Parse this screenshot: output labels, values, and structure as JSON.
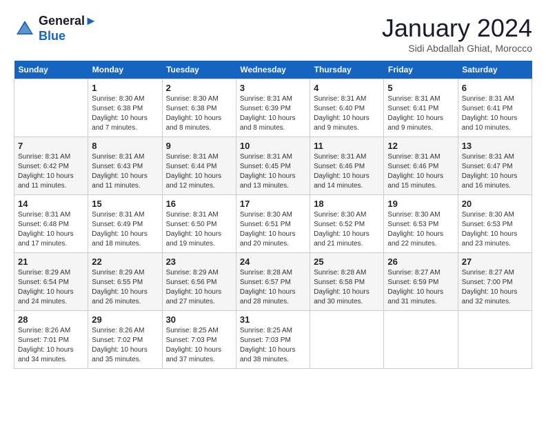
{
  "header": {
    "logo_line1": "General",
    "logo_line2": "Blue",
    "month_title": "January 2024",
    "subtitle": "Sidi Abdallah Ghiat, Morocco"
  },
  "days_of_week": [
    "Sunday",
    "Monday",
    "Tuesday",
    "Wednesday",
    "Thursday",
    "Friday",
    "Saturday"
  ],
  "weeks": [
    [
      {
        "day": "",
        "sunrise": "",
        "sunset": "",
        "daylight": ""
      },
      {
        "day": "1",
        "sunrise": "8:30 AM",
        "sunset": "6:38 PM",
        "daylight": "10 hours and 7 minutes."
      },
      {
        "day": "2",
        "sunrise": "8:30 AM",
        "sunset": "6:38 PM",
        "daylight": "10 hours and 8 minutes."
      },
      {
        "day": "3",
        "sunrise": "8:31 AM",
        "sunset": "6:39 PM",
        "daylight": "10 hours and 8 minutes."
      },
      {
        "day": "4",
        "sunrise": "8:31 AM",
        "sunset": "6:40 PM",
        "daylight": "10 hours and 9 minutes."
      },
      {
        "day": "5",
        "sunrise": "8:31 AM",
        "sunset": "6:41 PM",
        "daylight": "10 hours and 9 minutes."
      },
      {
        "day": "6",
        "sunrise": "8:31 AM",
        "sunset": "6:41 PM",
        "daylight": "10 hours and 10 minutes."
      }
    ],
    [
      {
        "day": "7",
        "sunrise": "8:31 AM",
        "sunset": "6:42 PM",
        "daylight": "10 hours and 11 minutes."
      },
      {
        "day": "8",
        "sunrise": "8:31 AM",
        "sunset": "6:43 PM",
        "daylight": "10 hours and 11 minutes."
      },
      {
        "day": "9",
        "sunrise": "8:31 AM",
        "sunset": "6:44 PM",
        "daylight": "10 hours and 12 minutes."
      },
      {
        "day": "10",
        "sunrise": "8:31 AM",
        "sunset": "6:45 PM",
        "daylight": "10 hours and 13 minutes."
      },
      {
        "day": "11",
        "sunrise": "8:31 AM",
        "sunset": "6:46 PM",
        "daylight": "10 hours and 14 minutes."
      },
      {
        "day": "12",
        "sunrise": "8:31 AM",
        "sunset": "6:46 PM",
        "daylight": "10 hours and 15 minutes."
      },
      {
        "day": "13",
        "sunrise": "8:31 AM",
        "sunset": "6:47 PM",
        "daylight": "10 hours and 16 minutes."
      }
    ],
    [
      {
        "day": "14",
        "sunrise": "8:31 AM",
        "sunset": "6:48 PM",
        "daylight": "10 hours and 17 minutes."
      },
      {
        "day": "15",
        "sunrise": "8:31 AM",
        "sunset": "6:49 PM",
        "daylight": "10 hours and 18 minutes."
      },
      {
        "day": "16",
        "sunrise": "8:31 AM",
        "sunset": "6:50 PM",
        "daylight": "10 hours and 19 minutes."
      },
      {
        "day": "17",
        "sunrise": "8:30 AM",
        "sunset": "6:51 PM",
        "daylight": "10 hours and 20 minutes."
      },
      {
        "day": "18",
        "sunrise": "8:30 AM",
        "sunset": "6:52 PM",
        "daylight": "10 hours and 21 minutes."
      },
      {
        "day": "19",
        "sunrise": "8:30 AM",
        "sunset": "6:53 PM",
        "daylight": "10 hours and 22 minutes."
      },
      {
        "day": "20",
        "sunrise": "8:30 AM",
        "sunset": "6:53 PM",
        "daylight": "10 hours and 23 minutes."
      }
    ],
    [
      {
        "day": "21",
        "sunrise": "8:29 AM",
        "sunset": "6:54 PM",
        "daylight": "10 hours and 24 minutes."
      },
      {
        "day": "22",
        "sunrise": "8:29 AM",
        "sunset": "6:55 PM",
        "daylight": "10 hours and 26 minutes."
      },
      {
        "day": "23",
        "sunrise": "8:29 AM",
        "sunset": "6:56 PM",
        "daylight": "10 hours and 27 minutes."
      },
      {
        "day": "24",
        "sunrise": "8:28 AM",
        "sunset": "6:57 PM",
        "daylight": "10 hours and 28 minutes."
      },
      {
        "day": "25",
        "sunrise": "8:28 AM",
        "sunset": "6:58 PM",
        "daylight": "10 hours and 30 minutes."
      },
      {
        "day": "26",
        "sunrise": "8:27 AM",
        "sunset": "6:59 PM",
        "daylight": "10 hours and 31 minutes."
      },
      {
        "day": "27",
        "sunrise": "8:27 AM",
        "sunset": "7:00 PM",
        "daylight": "10 hours and 32 minutes."
      }
    ],
    [
      {
        "day": "28",
        "sunrise": "8:26 AM",
        "sunset": "7:01 PM",
        "daylight": "10 hours and 34 minutes."
      },
      {
        "day": "29",
        "sunrise": "8:26 AM",
        "sunset": "7:02 PM",
        "daylight": "10 hours and 35 minutes."
      },
      {
        "day": "30",
        "sunrise": "8:25 AM",
        "sunset": "7:03 PM",
        "daylight": "10 hours and 37 minutes."
      },
      {
        "day": "31",
        "sunrise": "8:25 AM",
        "sunset": "7:03 PM",
        "daylight": "10 hours and 38 minutes."
      },
      {
        "day": "",
        "sunrise": "",
        "sunset": "",
        "daylight": ""
      },
      {
        "day": "",
        "sunrise": "",
        "sunset": "",
        "daylight": ""
      },
      {
        "day": "",
        "sunrise": "",
        "sunset": "",
        "daylight": ""
      }
    ]
  ],
  "labels": {
    "sunrise_label": "Sunrise:",
    "sunset_label": "Sunset:",
    "daylight_label": "Daylight:"
  }
}
